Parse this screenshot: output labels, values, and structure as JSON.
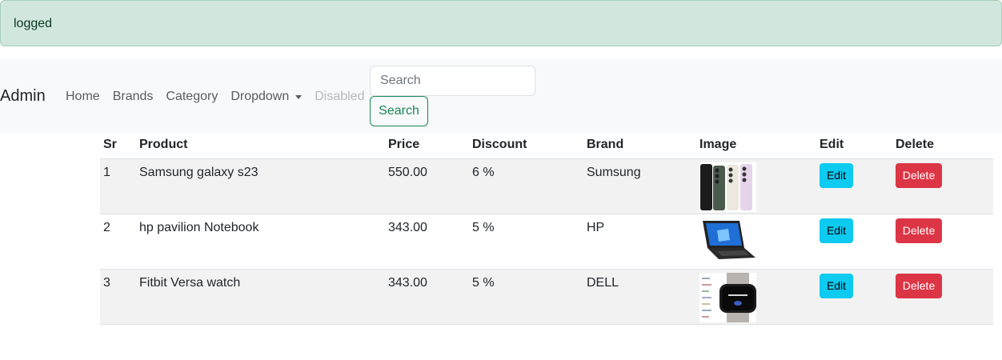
{
  "alert": {
    "text": "logged"
  },
  "navbar": {
    "brand": "Admin",
    "links": [
      "Home",
      "Brands",
      "Category"
    ],
    "dropdown_label": "Dropdown",
    "disabled_label": "Disabled",
    "search_placeholder": "Search",
    "search_button": "Search",
    "colors": {
      "success": "#198754",
      "alert_bg": "#d1e7dd"
    }
  },
  "table": {
    "headers": [
      "Sr",
      "Product",
      "Price",
      "Discount",
      "Brand",
      "Image",
      "Edit",
      "Delete"
    ],
    "rows": [
      {
        "sr": "1",
        "product": "Samsung galaxy s23",
        "price": "550.00",
        "discount": "6 %",
        "brand": "Sumsung",
        "image_icon": "smartphones-image",
        "edit": "Edit",
        "delete": "Delete"
      },
      {
        "sr": "2",
        "product": "hp pavilion Notebook",
        "price": "343.00",
        "discount": "5 %",
        "brand": "HP",
        "image_icon": "laptop-image",
        "edit": "Edit",
        "delete": "Delete"
      },
      {
        "sr": "3",
        "product": "Fitbit Versa watch",
        "price": "343.00",
        "discount": "5 %",
        "brand": "DELL",
        "image_icon": "smartwatch-image",
        "edit": "Edit",
        "delete": "Delete"
      }
    ],
    "colors": {
      "edit": "#0dcaf0",
      "delete": "#dc3545"
    }
  }
}
